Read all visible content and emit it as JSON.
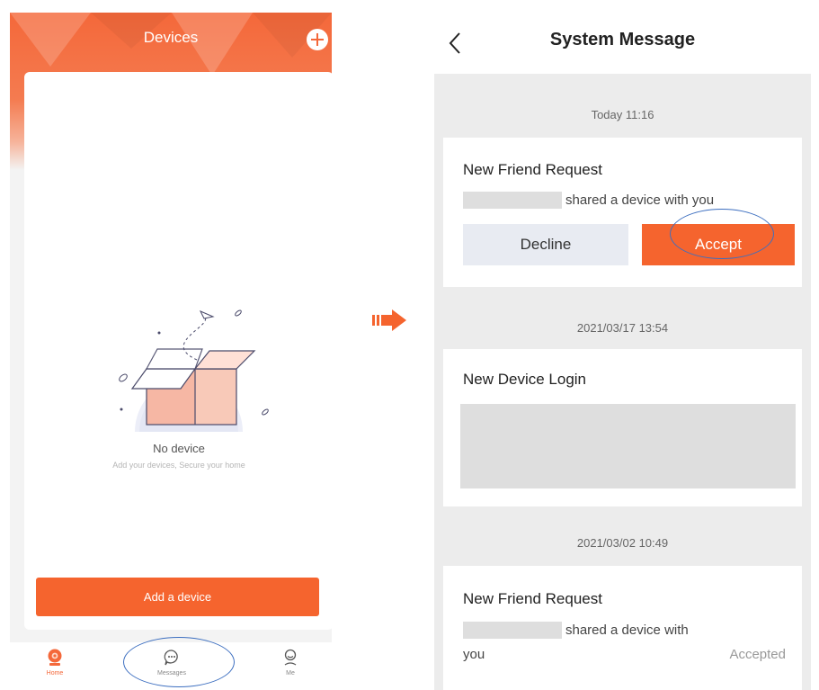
{
  "left": {
    "header_title": "Devices",
    "empty_title": "No device",
    "empty_subtitle": "Add your devices, Secure your home",
    "add_button": "Add a device",
    "tabs": [
      {
        "label": "Home",
        "icon": "camera-icon",
        "active": true
      },
      {
        "label": "Messages",
        "icon": "chat-bubble-icon",
        "active": false
      },
      {
        "label": "Me",
        "icon": "person-icon",
        "active": false
      }
    ]
  },
  "right": {
    "title": "System Message",
    "messages": [
      {
        "time": "Today  11:16",
        "title": "New Friend Request",
        "text": "shared a device with you",
        "decline_label": "Decline",
        "accept_label": "Accept"
      },
      {
        "time": "2021/03/17 13:54",
        "title": "New Device Login"
      },
      {
        "time": "2021/03/02 10:49",
        "title": "New Friend Request",
        "text_line1": "shared a device with",
        "text_line2": "you",
        "status": "Accepted"
      }
    ]
  },
  "colors": {
    "accent": "#f5642e",
    "highlight_ring": "#3d6fc0",
    "decline_bg": "#e8ebf2"
  }
}
